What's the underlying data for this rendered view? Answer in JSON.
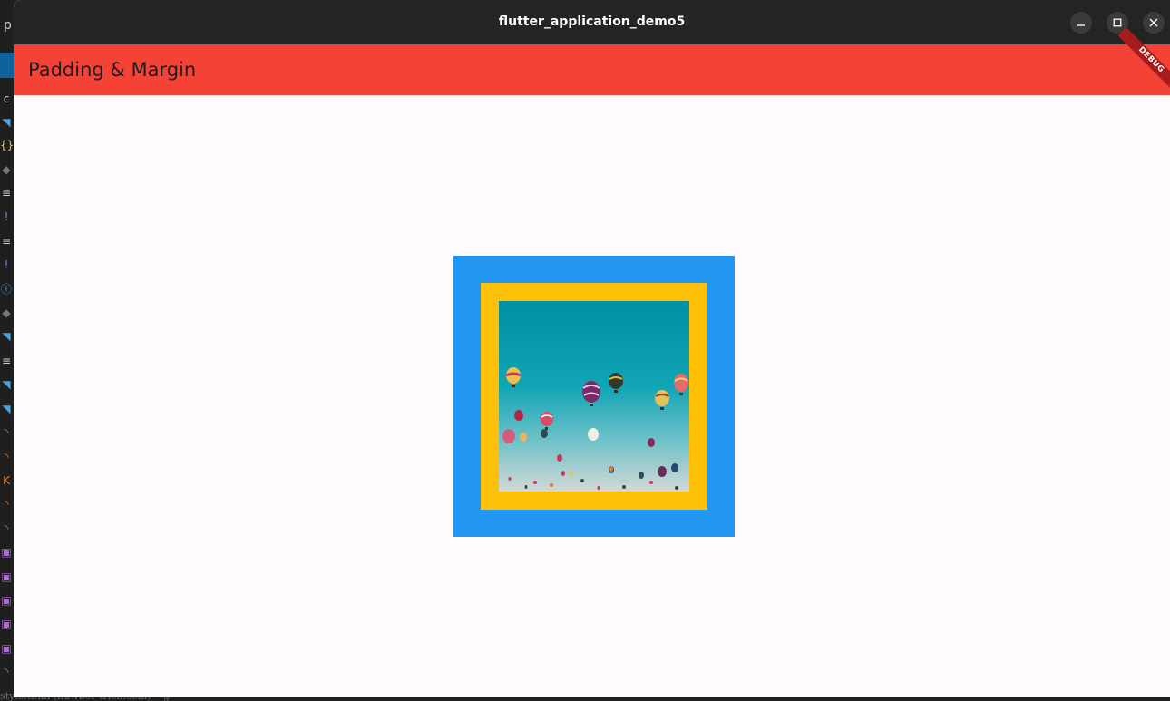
{
  "window": {
    "title": "flutter_application_demo5",
    "controls": {
      "minimize_icon": "minimize-icon",
      "maximize_icon": "maximize-icon",
      "close_icon": "close-icon"
    }
  },
  "appbar": {
    "title": "Padding & Margin",
    "color": "#f44336"
  },
  "debug_banner": {
    "label": "DEBUG"
  },
  "content": {
    "outer_color": "#2196f3",
    "inner_color": "#ffc107",
    "image": {
      "subject": "hot air balloons in a teal sky"
    }
  },
  "background_editor": {
    "tab_glyph": "p",
    "letter_glyph": "c",
    "bottom_text": "style.ti.im   (fluwber tricn.com) • g"
  }
}
